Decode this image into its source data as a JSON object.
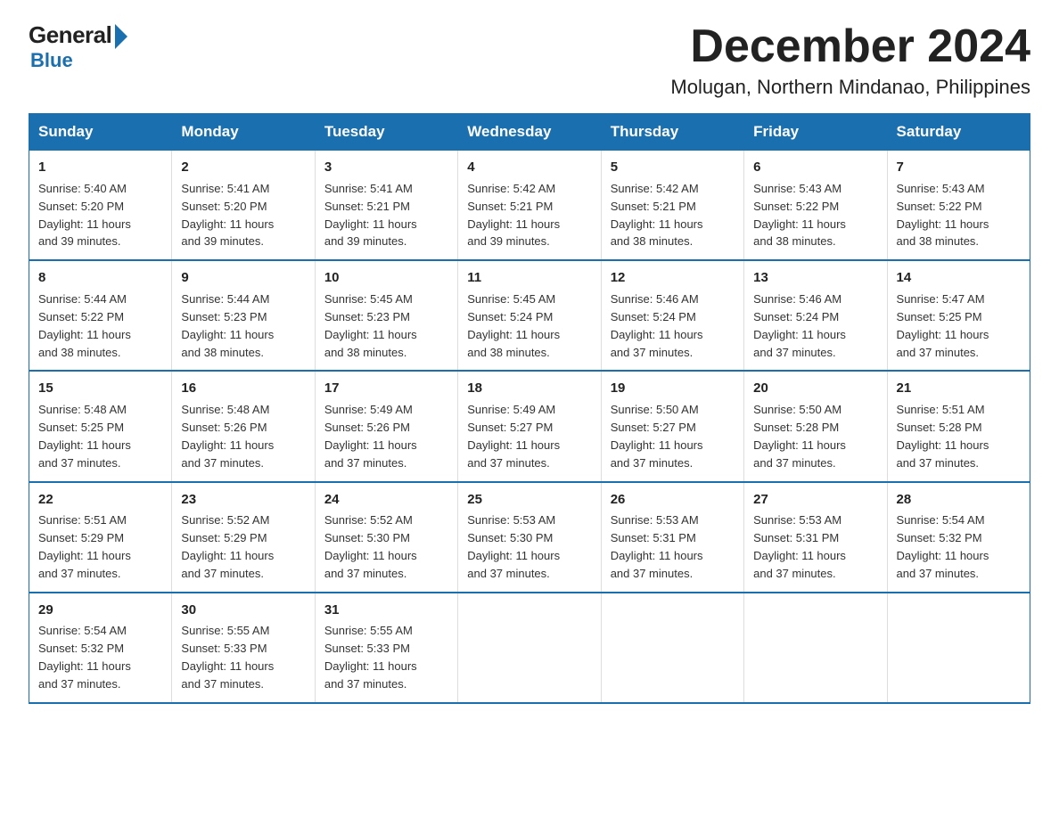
{
  "logo": {
    "general": "General",
    "blue": "Blue"
  },
  "title": "December 2024",
  "location": "Molugan, Northern Mindanao, Philippines",
  "days_of_week": [
    "Sunday",
    "Monday",
    "Tuesday",
    "Wednesday",
    "Thursday",
    "Friday",
    "Saturday"
  ],
  "weeks": [
    [
      {
        "num": "1",
        "rise": "5:40 AM",
        "set": "5:20 PM",
        "daylight": "11 hours and 39 minutes."
      },
      {
        "num": "2",
        "rise": "5:41 AM",
        "set": "5:20 PM",
        "daylight": "11 hours and 39 minutes."
      },
      {
        "num": "3",
        "rise": "5:41 AM",
        "set": "5:21 PM",
        "daylight": "11 hours and 39 minutes."
      },
      {
        "num": "4",
        "rise": "5:42 AM",
        "set": "5:21 PM",
        "daylight": "11 hours and 39 minutes."
      },
      {
        "num": "5",
        "rise": "5:42 AM",
        "set": "5:21 PM",
        "daylight": "11 hours and 38 minutes."
      },
      {
        "num": "6",
        "rise": "5:43 AM",
        "set": "5:22 PM",
        "daylight": "11 hours and 38 minutes."
      },
      {
        "num": "7",
        "rise": "5:43 AM",
        "set": "5:22 PM",
        "daylight": "11 hours and 38 minutes."
      }
    ],
    [
      {
        "num": "8",
        "rise": "5:44 AM",
        "set": "5:22 PM",
        "daylight": "11 hours and 38 minutes."
      },
      {
        "num": "9",
        "rise": "5:44 AM",
        "set": "5:23 PM",
        "daylight": "11 hours and 38 minutes."
      },
      {
        "num": "10",
        "rise": "5:45 AM",
        "set": "5:23 PM",
        "daylight": "11 hours and 38 minutes."
      },
      {
        "num": "11",
        "rise": "5:45 AM",
        "set": "5:24 PM",
        "daylight": "11 hours and 38 minutes."
      },
      {
        "num": "12",
        "rise": "5:46 AM",
        "set": "5:24 PM",
        "daylight": "11 hours and 37 minutes."
      },
      {
        "num": "13",
        "rise": "5:46 AM",
        "set": "5:24 PM",
        "daylight": "11 hours and 37 minutes."
      },
      {
        "num": "14",
        "rise": "5:47 AM",
        "set": "5:25 PM",
        "daylight": "11 hours and 37 minutes."
      }
    ],
    [
      {
        "num": "15",
        "rise": "5:48 AM",
        "set": "5:25 PM",
        "daylight": "11 hours and 37 minutes."
      },
      {
        "num": "16",
        "rise": "5:48 AM",
        "set": "5:26 PM",
        "daylight": "11 hours and 37 minutes."
      },
      {
        "num": "17",
        "rise": "5:49 AM",
        "set": "5:26 PM",
        "daylight": "11 hours and 37 minutes."
      },
      {
        "num": "18",
        "rise": "5:49 AM",
        "set": "5:27 PM",
        "daylight": "11 hours and 37 minutes."
      },
      {
        "num": "19",
        "rise": "5:50 AM",
        "set": "5:27 PM",
        "daylight": "11 hours and 37 minutes."
      },
      {
        "num": "20",
        "rise": "5:50 AM",
        "set": "5:28 PM",
        "daylight": "11 hours and 37 minutes."
      },
      {
        "num": "21",
        "rise": "5:51 AM",
        "set": "5:28 PM",
        "daylight": "11 hours and 37 minutes."
      }
    ],
    [
      {
        "num": "22",
        "rise": "5:51 AM",
        "set": "5:29 PM",
        "daylight": "11 hours and 37 minutes."
      },
      {
        "num": "23",
        "rise": "5:52 AM",
        "set": "5:29 PM",
        "daylight": "11 hours and 37 minutes."
      },
      {
        "num": "24",
        "rise": "5:52 AM",
        "set": "5:30 PM",
        "daylight": "11 hours and 37 minutes."
      },
      {
        "num": "25",
        "rise": "5:53 AM",
        "set": "5:30 PM",
        "daylight": "11 hours and 37 minutes."
      },
      {
        "num": "26",
        "rise": "5:53 AM",
        "set": "5:31 PM",
        "daylight": "11 hours and 37 minutes."
      },
      {
        "num": "27",
        "rise": "5:53 AM",
        "set": "5:31 PM",
        "daylight": "11 hours and 37 minutes."
      },
      {
        "num": "28",
        "rise": "5:54 AM",
        "set": "5:32 PM",
        "daylight": "11 hours and 37 minutes."
      }
    ],
    [
      {
        "num": "29",
        "rise": "5:54 AM",
        "set": "5:32 PM",
        "daylight": "11 hours and 37 minutes."
      },
      {
        "num": "30",
        "rise": "5:55 AM",
        "set": "5:33 PM",
        "daylight": "11 hours and 37 minutes."
      },
      {
        "num": "31",
        "rise": "5:55 AM",
        "set": "5:33 PM",
        "daylight": "11 hours and 37 minutes."
      },
      null,
      null,
      null,
      null
    ]
  ],
  "labels": {
    "sunrise": "Sunrise:",
    "sunset": "Sunset:",
    "daylight": "Daylight:"
  }
}
